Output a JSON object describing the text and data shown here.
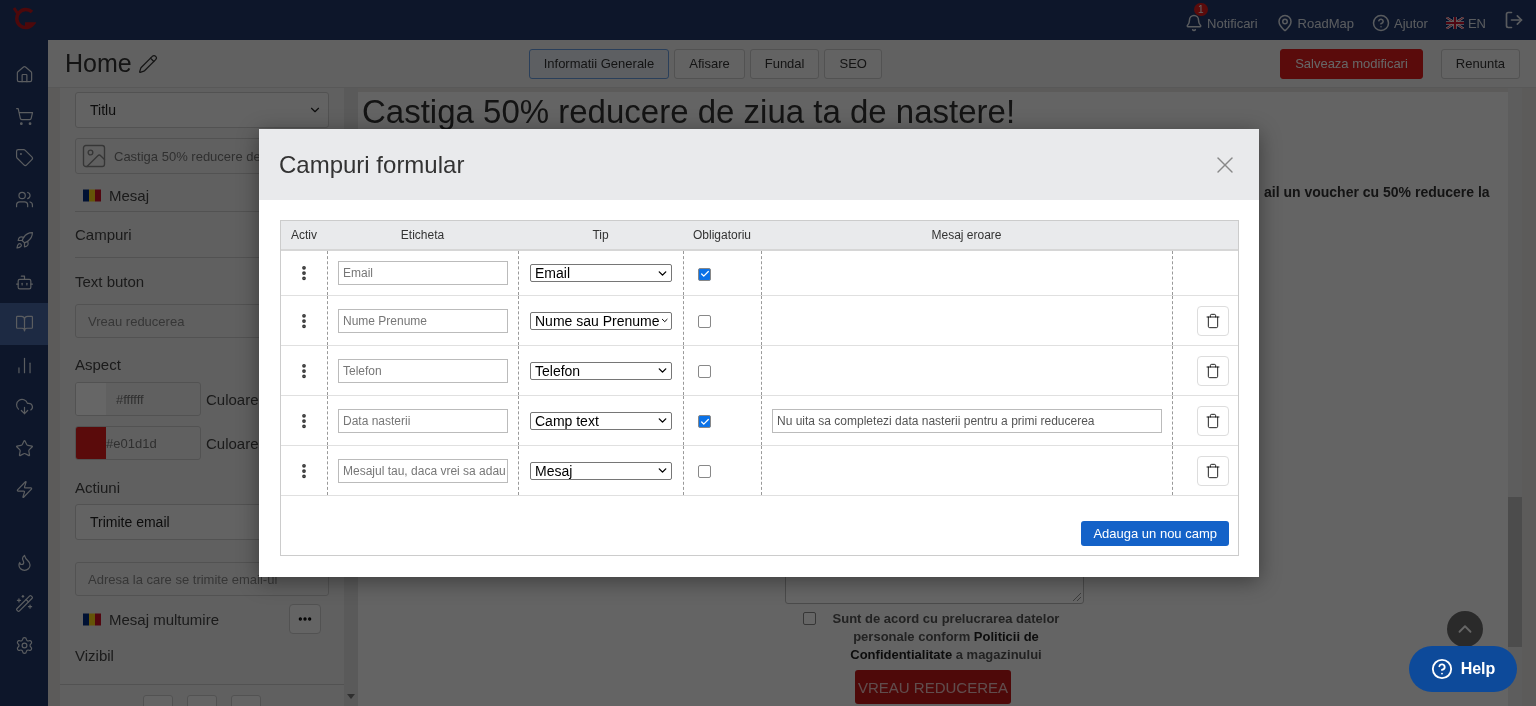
{
  "top_bar": {
    "notifications": {
      "label": "Notificari",
      "badge": "1"
    },
    "links": [
      {
        "kind": "roadmap",
        "label": "RoadMap"
      },
      {
        "kind": "help",
        "label": "Ajutor"
      }
    ],
    "language": "EN"
  },
  "sidebar": {
    "main_items": [
      {
        "selected": false
      },
      {
        "selected": false
      },
      {
        "selected": false
      },
      {
        "selected": false
      },
      {
        "selected": false
      },
      {
        "selected": false
      },
      {
        "selected": true
      },
      {
        "selected": false
      },
      {
        "selected": false
      },
      {
        "selected": false
      },
      {
        "selected": false
      }
    ],
    "bottom_items": [
      {
        "selected": false
      },
      {
        "selected": false
      },
      {
        "selected": false
      }
    ]
  },
  "header": {
    "title": "Home",
    "tabs": [
      {
        "label": "Informatii Generale",
        "selected": true
      },
      {
        "label": "Afisare",
        "selected": false
      },
      {
        "label": "Fundal",
        "selected": false
      },
      {
        "label": "SEO",
        "selected": false
      }
    ],
    "buttons": [
      {
        "kind": "primary",
        "label": "Salveaza modificari"
      },
      {
        "kind": "secondary",
        "label": "Renunta"
      }
    ]
  },
  "editor_panel": {
    "title_select": "Titlu",
    "image_text": "Castiga 50% reducere de",
    "message_label": "Mesaj",
    "fields_label": "Campuri",
    "button_text_label": "Text buton",
    "button_text_value": "Vreau reducerea",
    "aspect_label": "Aspect",
    "colors": [
      {
        "value": "#ffffff",
        "label": "Culoare"
      },
      {
        "value": "#e01d1d",
        "label": "Culoare"
      }
    ],
    "actions_label": "Actiuni",
    "action_select": "Trimite email",
    "email_placeholder": "Adresa la care se trimite email-ul",
    "thanks_label": "Mesaj multumire",
    "visible_label": "Vizibil"
  },
  "preview": {
    "heading": "Castiga 50% reducere de ziua ta de nastere!",
    "text": "ail un voucher cu 50% reducere la",
    "consent": {
      "checked": false,
      "text": "Sunt de acord cu prelucrarea datelor personale conform **Politicii de Confidentialitate** a magazinului"
    },
    "button": "VREAU REDUCEREA"
  },
  "modal": {
    "title": "Campuri formular",
    "columns": [
      "Activ",
      "Eticheta",
      "Tip",
      "Obligatoriu",
      "Mesaj eroare"
    ],
    "rows": [
      {
        "label": "Email",
        "type": "Email",
        "required": true,
        "deletable": false
      },
      {
        "label": "Nume Prenume",
        "type": "Nume sau Prenume",
        "required": false,
        "deletable": true
      },
      {
        "label": "Telefon",
        "type": "Telefon",
        "required": false,
        "deletable": true
      },
      {
        "label": "Data nasterii",
        "type": "Camp text",
        "required": true,
        "error_message": "Nu uita sa completezi data nasterii pentru a primi reducerea",
        "deletable": true
      },
      {
        "label": "Mesajul tau, daca vrei sa adau",
        "type": "Mesaj",
        "required": false,
        "deletable": true
      }
    ],
    "add_button": "Adauga un nou camp"
  },
  "help_button": "Help"
}
